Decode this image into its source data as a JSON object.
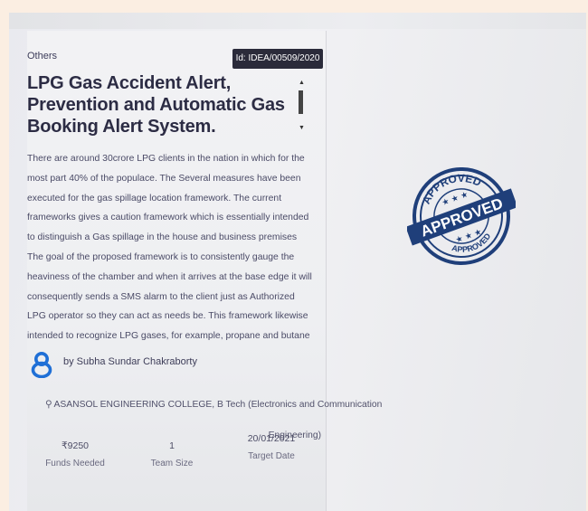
{
  "card": {
    "category": "Others",
    "id_label": "Id: IDEA/00509/2020",
    "title": "LPG Gas Accident Alert, Prevention and Automatic Gas Booking Alert System.",
    "description": "There are around 30crore LPG clients in the nation in which for the most part 40% of the populace. The Several measures have been executed for the gas spillage location framework. The current frameworks gives a caution framework which is essentially intended to distinguish a Gas spillage in the house and business premises The goal of the proposed framework is to consistently gauge the heaviness of the chamber and when it arrives at the base edge it will consequently sends a SMS alarm to the client just as Authorized LPG operator so they can act as needs be. This framework likewise intended to recognize LPG gases, for example, propane and butane",
    "author": "by Subha Sundar Chakraborty",
    "college_line1": "ASANSOL ENGINEERING COLLEGE, B Tech (Electronics and Communication",
    "college_line2": "Engineering)",
    "stats": [
      {
        "value": "₹9250",
        "label": "Funds Needed"
      },
      {
        "value": "1",
        "label": "Team Size"
      },
      {
        "value": "20/01/2021",
        "label": "Target Date"
      }
    ]
  },
  "stamp": {
    "top_text": "APPROVED",
    "center_text": "APPROVED",
    "bottom_text": "APPROVED",
    "color": "#1f3f7a"
  },
  "colors": {
    "badge_bg": "#2b2b3a",
    "title": "#2c2c44",
    "author_icon": "#1f6fd6"
  }
}
